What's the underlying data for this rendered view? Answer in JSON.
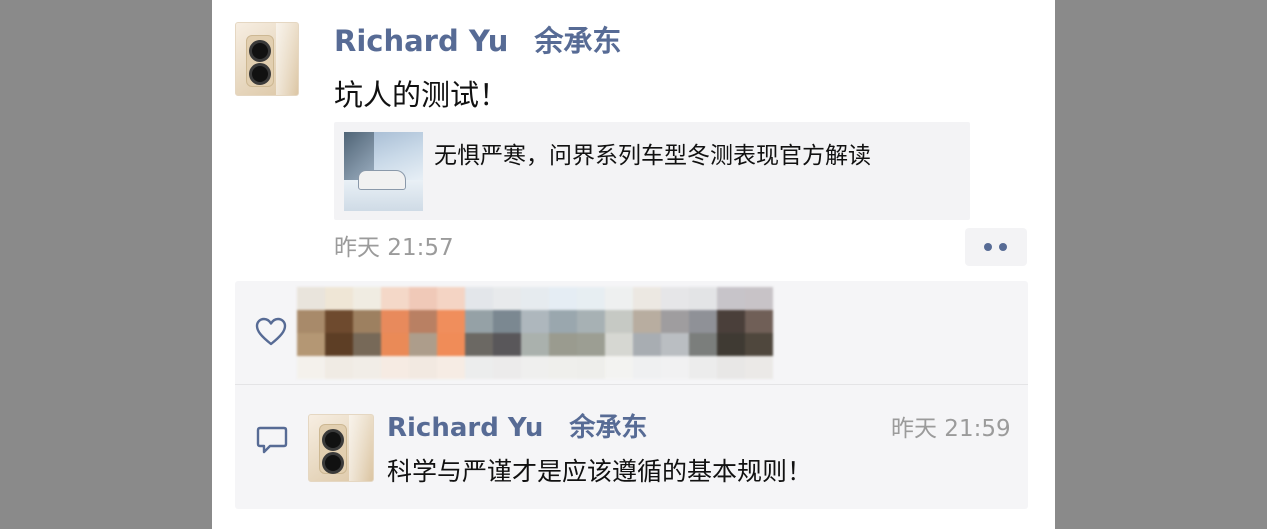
{
  "post": {
    "author_en": "Richard Yu",
    "author_cn": "余承东",
    "content": "坑人的测试！",
    "link_title": "无惧严寒，问界系列车型冬测表现官方解读",
    "time": "昨天 21:57"
  },
  "comment": {
    "author_en": "Richard Yu",
    "author_cn": "余承东",
    "time": "昨天 21:59",
    "content": "科学与严谨才是应该遵循的基本规则！"
  },
  "icons": {
    "like": "heart-outline-icon",
    "comment": "speech-bubble-icon",
    "more": "more-dots-icon"
  },
  "colors": {
    "name_link": "#576b95",
    "timestamp": "#9b9b9b",
    "card_bg": "#f3f3f5"
  }
}
